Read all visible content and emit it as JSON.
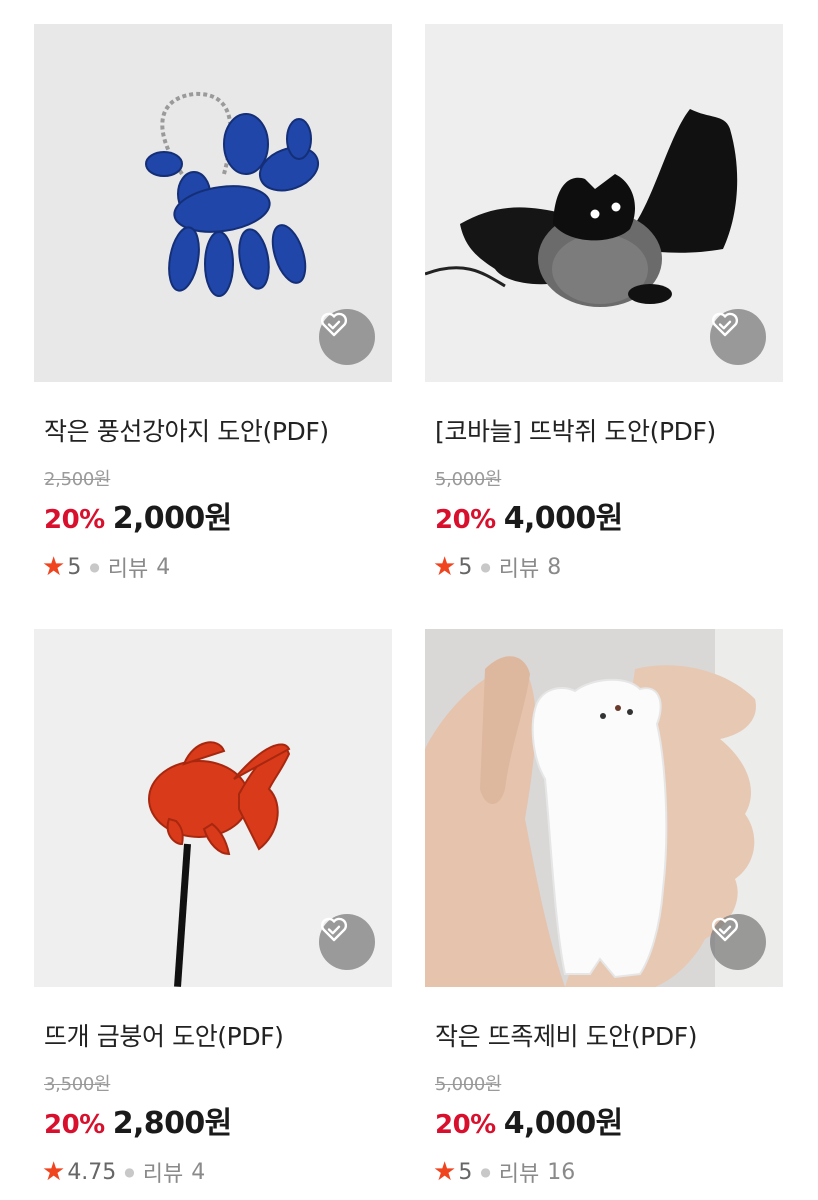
{
  "products": [
    {
      "title": "작은 풍선강아지 도안(PDF)",
      "original_price": "2,500원",
      "discount": "20%",
      "price": "2,000원",
      "rating": "5",
      "review_label": "리뷰",
      "review_count": "4",
      "image_icon": "blue-balloon-dog-keychain-image"
    },
    {
      "title": "[코바늘] 뜨박쥐 도안(PDF)",
      "original_price": "5,000원",
      "discount": "20%",
      "price": "4,000원",
      "rating": "5",
      "review_label": "리뷰",
      "review_count": "8",
      "image_icon": "knitted-bat-image"
    },
    {
      "title": "뜨개 금붕어 도안(PDF)",
      "original_price": "3,500원",
      "discount": "20%",
      "price": "2,800원",
      "rating": "4.75",
      "review_label": "리뷰",
      "review_count": "4",
      "image_icon": "knitted-goldfish-image"
    },
    {
      "title": "작은 뜨족제비 도안(PDF)",
      "original_price": "5,000원",
      "discount": "20%",
      "price": "4,000원",
      "rating": "5",
      "review_label": "리뷰",
      "review_count": "16",
      "image_icon": "knitted-weasel-in-hand-image"
    }
  ],
  "colors": {
    "discount": "#d8102d",
    "star": "#f0441f",
    "wish_button_bg": "#787878"
  },
  "icons": {
    "wish": "heart-check-icon",
    "rating": "star-icon"
  }
}
